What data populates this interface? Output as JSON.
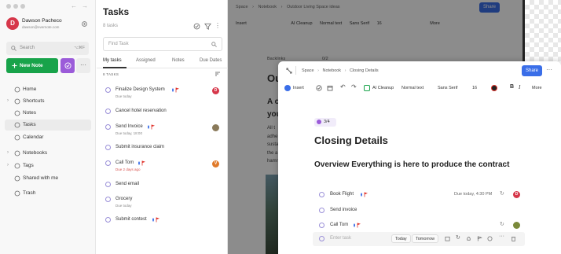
{
  "window": {
    "back_glyph": "←",
    "forward_glyph": "→"
  },
  "user": {
    "initial": "D",
    "name": "Dawson Pacheco",
    "email": "dawson@evernote.com"
  },
  "sidebar": {
    "search_placeholder": "Search",
    "search_shortcut": "⌥⌘F",
    "new_note_label": "New Note",
    "more_label": "···",
    "items": [
      {
        "label": "Home",
        "icon": "home-icon"
      },
      {
        "label": "Shortcuts",
        "icon": "star-icon"
      },
      {
        "label": "Notes",
        "icon": "note-icon"
      },
      {
        "label": "Tasks",
        "icon": "check-circle-icon"
      },
      {
        "label": "Calendar",
        "icon": "calendar-icon"
      },
      {
        "label": "Notebooks",
        "icon": "notebook-icon"
      },
      {
        "label": "Tags",
        "icon": "tag-icon"
      },
      {
        "label": "Shared with me",
        "icon": "people-icon"
      },
      {
        "label": "Trash",
        "icon": "trash-icon"
      }
    ]
  },
  "tasks_panel": {
    "title": "Tasks",
    "count": "8 tasks",
    "find_placeholder": "Find Task",
    "tabs": [
      "My tasks",
      "Assigned",
      "Notes",
      "Due Dates"
    ],
    "group_label": "8 TASKS",
    "items": [
      {
        "title": "Finalize Design System",
        "meta": "Due today",
        "meta_red": false,
        "has_flags": true,
        "avatar": "D",
        "avatar_color": "#d6374a"
      },
      {
        "title": "Cancel hotel reservation",
        "meta": "",
        "meta_red": false,
        "has_flags": false,
        "avatar": "",
        "avatar_color": ""
      },
      {
        "title": "Send Invoice",
        "meta": "Due today, 18:00",
        "meta_red": false,
        "has_flags": true,
        "avatar": "",
        "avatar_color": "#8a7a5a"
      },
      {
        "title": "Submit insurance claim",
        "meta": "",
        "meta_red": false,
        "has_flags": false,
        "avatar": "",
        "avatar_color": ""
      },
      {
        "title": "Call Tom",
        "meta": "Due 2 days ago",
        "meta_red": true,
        "has_flags": true,
        "avatar": "V",
        "avatar_color": "#e07a2a"
      },
      {
        "title": "Send email",
        "meta": "",
        "meta_red": false,
        "has_flags": false,
        "avatar": "",
        "avatar_color": ""
      },
      {
        "title": "Grocery",
        "meta": "Due today",
        "meta_red": false,
        "has_flags": false,
        "avatar": "",
        "avatar_color": ""
      },
      {
        "title": "Submit contest",
        "meta": "",
        "meta_red": false,
        "has_flags": true,
        "avatar": "",
        "avatar_color": ""
      }
    ]
  },
  "background_editor": {
    "breadcrumb": [
      "Space",
      "Notebook",
      "Outdoor Living Space ideas"
    ],
    "share_label": "Share",
    "toolbar": {
      "insert": "Insert",
      "ai_cleanup": "AI Cleanup",
      "style": "Normal text",
      "font": "Sans Serif",
      "size": "16",
      "more": "More"
    },
    "tag_label": "Backlinks",
    "progress": "0/2",
    "heading_partial": "Ou",
    "h2_partial_1": "A c",
    "h2_partial_2": "you",
    "body_lines": [
      "All t",
      "adhe",
      "susta",
      "the a",
      "hamr"
    ]
  },
  "modal": {
    "breadcrumb": [
      "Space",
      "Notebook",
      "Closing Details"
    ],
    "share_label": "Share",
    "toolbar": {
      "insert": "Insert",
      "ai_cleanup": "AI Cleanup",
      "style": "Normal text",
      "font": "Sans Serif",
      "size": "16",
      "more": "More"
    },
    "progress": "3/4",
    "title": "Closing Details",
    "subtitle": "Overview Everything is here to produce the contract",
    "tasks": [
      {
        "title": "Book Flight",
        "due": "Due today, 4:30 PM",
        "avatar": "D",
        "avatar_color": "#d6374a"
      },
      {
        "title": "Send invoice",
        "due": "",
        "avatar": "",
        "avatar_color": ""
      },
      {
        "title": "Call Tom",
        "due": "",
        "avatar": "",
        "avatar_color": "#7a8a3a"
      }
    ],
    "new_task_placeholder": "Enter task",
    "today_label": "Today",
    "tomorrow_label": "Tomorrow"
  },
  "colors": {
    "accent_green": "#18a34a",
    "accent_purple": "#9b5bd9",
    "share_blue": "#3a6ee8",
    "flag_red": "#e0322a",
    "drop_blue": "#3a6ee8"
  }
}
